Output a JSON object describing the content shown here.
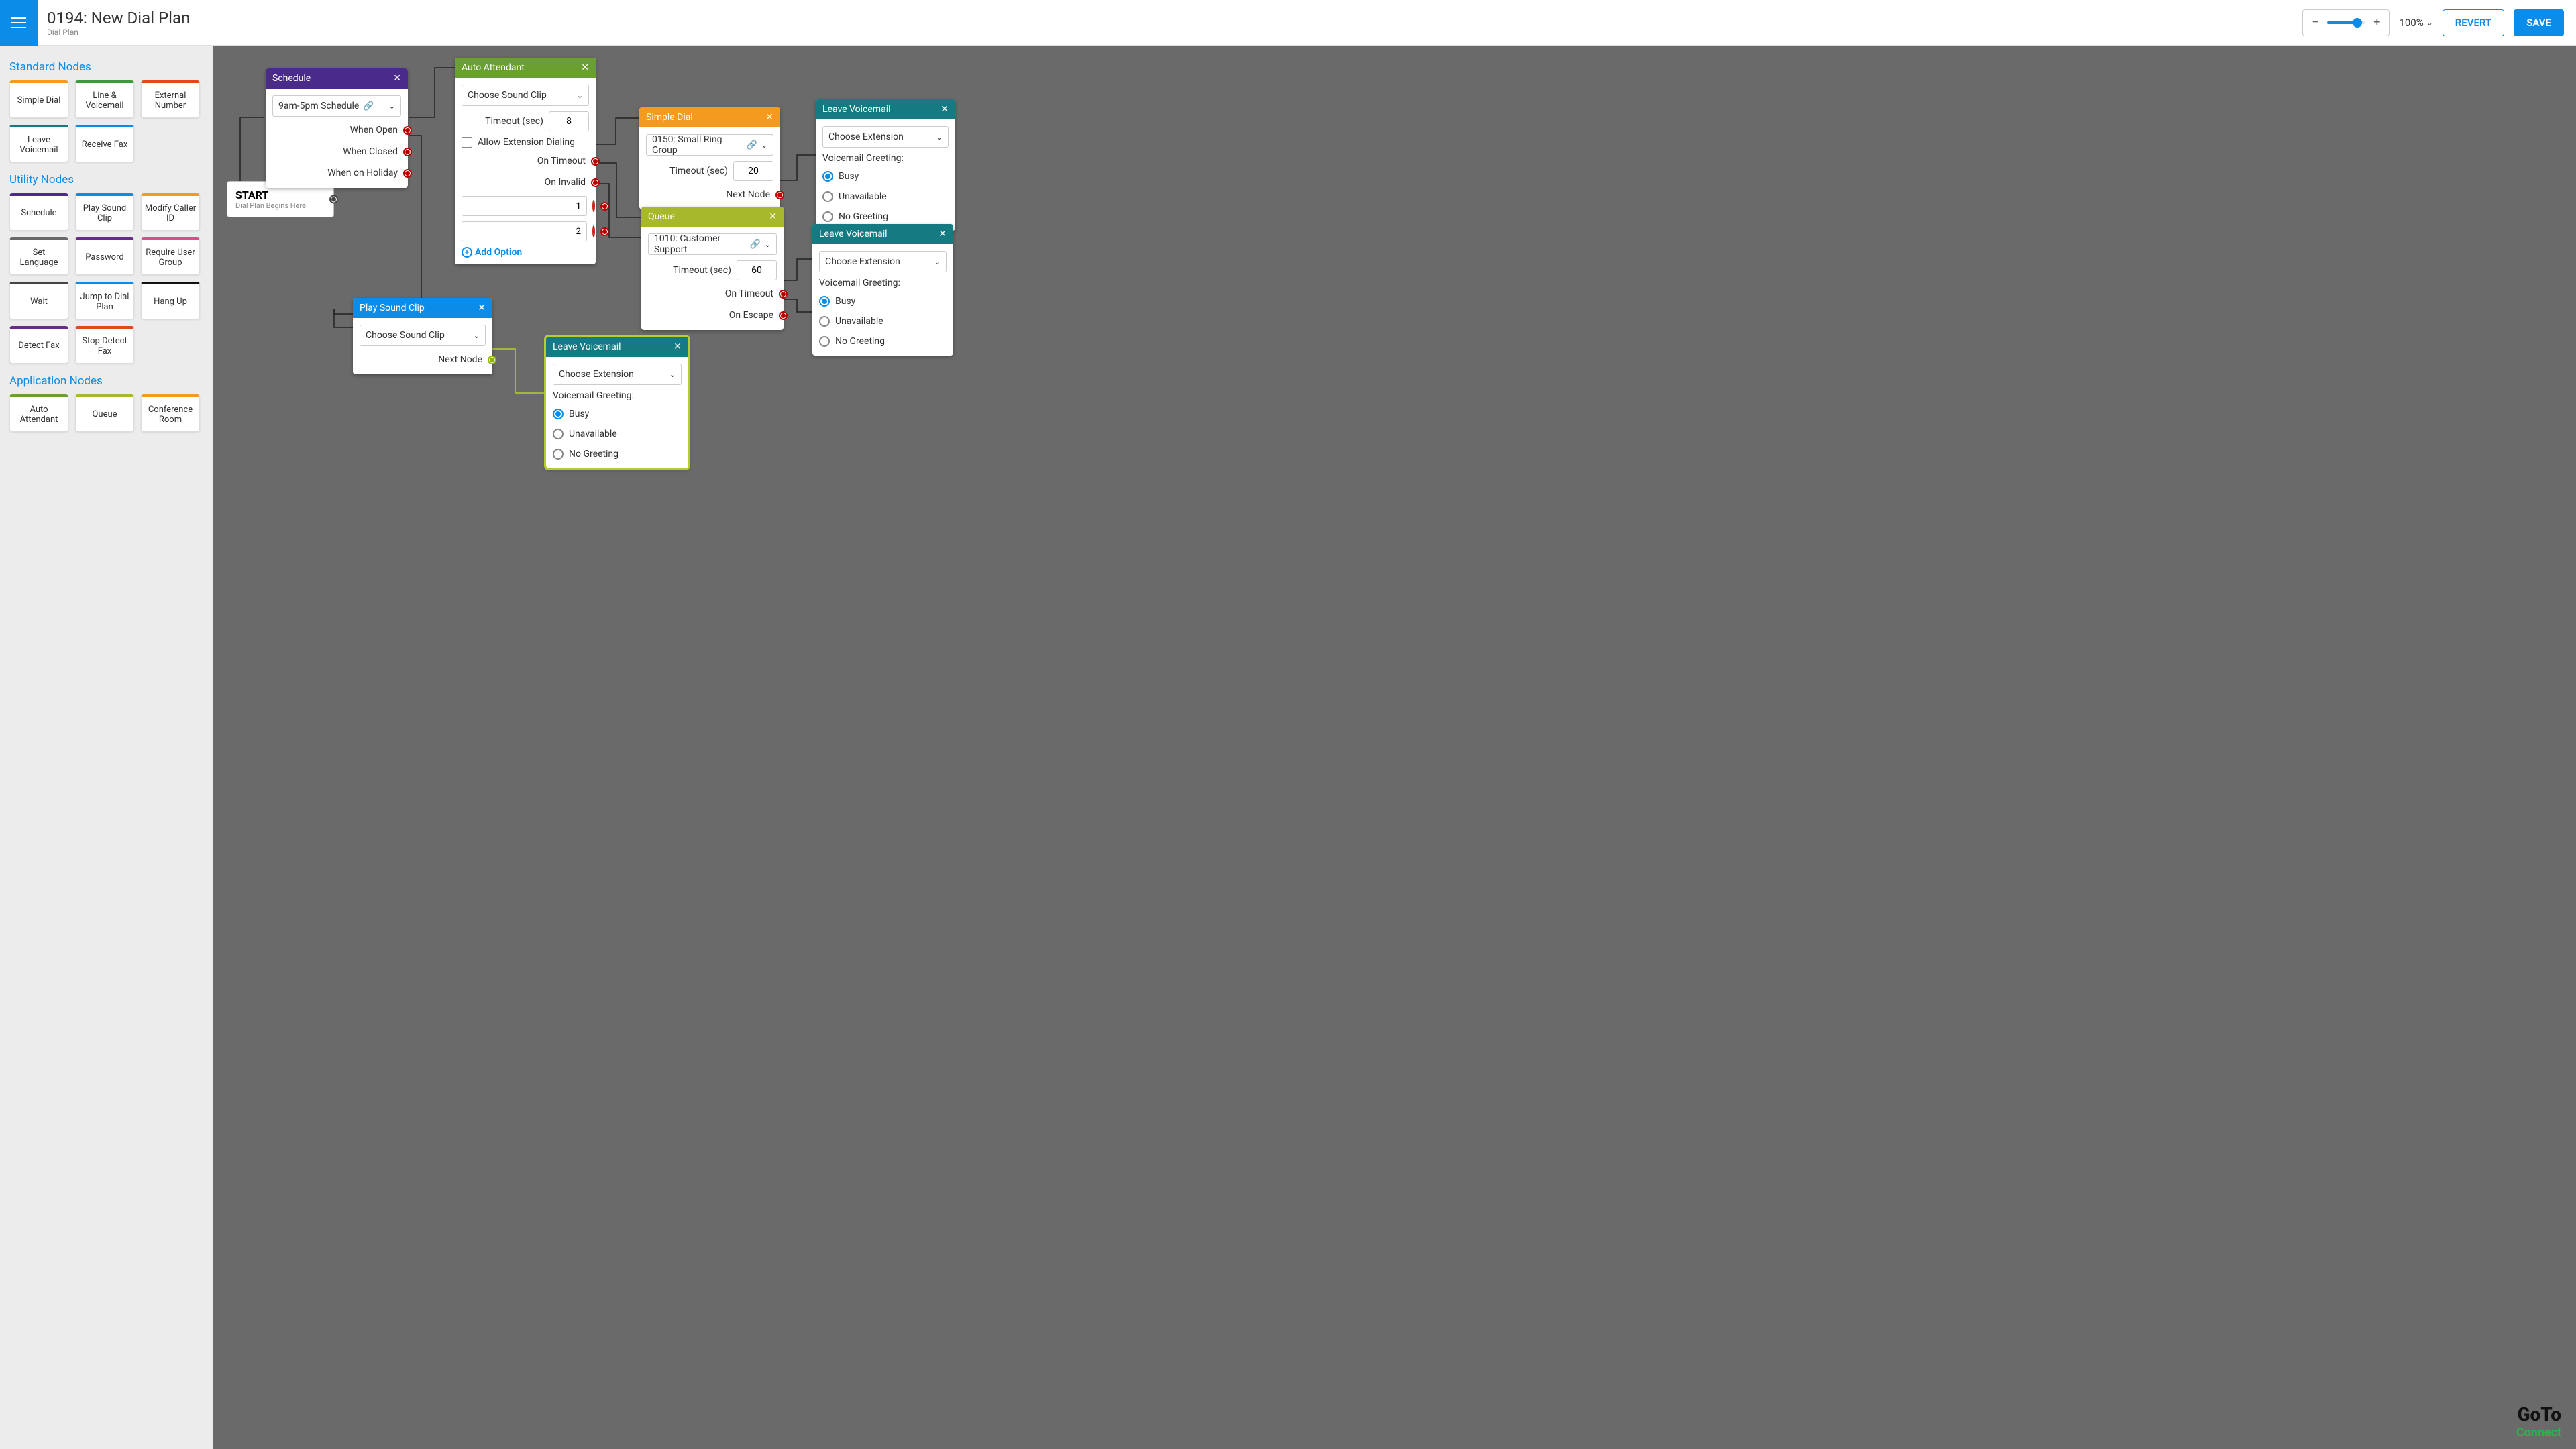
{
  "header": {
    "title": "0194: New Dial Plan",
    "subtitle": "Dial Plan"
  },
  "zoom": {
    "value": "100%"
  },
  "buttons": {
    "revert": "REVERT",
    "save": "SAVE"
  },
  "palette": {
    "standard": {
      "title": "Standard Nodes",
      "items": [
        {
          "label": "Simple Dial",
          "color": "#f39a1f"
        },
        {
          "label": "Line & Voicemail",
          "color": "#3b9b3b"
        },
        {
          "label": "External Number",
          "color": "#e04a1a"
        },
        {
          "label": "Leave Voicemail",
          "color": "#167a82"
        },
        {
          "label": "Receive Fax",
          "color": "#0c8ce9"
        }
      ]
    },
    "utility": {
      "title": "Utility Nodes",
      "items": [
        {
          "label": "Schedule",
          "color": "#4a2b8a"
        },
        {
          "label": "Play Sound Clip",
          "color": "#0c8ce9"
        },
        {
          "label": "Modify Caller ID",
          "color": "#f39a1f"
        },
        {
          "label": "Set Language",
          "color": "#6a6a6a"
        },
        {
          "label": "Password",
          "color": "#6a2a8a"
        },
        {
          "label": "Require User Group",
          "color": "#e24a8a"
        },
        {
          "label": "Wait",
          "color": "#444"
        },
        {
          "label": "Jump to Dial Plan",
          "color": "#0c8ce9"
        },
        {
          "label": "Hang Up",
          "color": "#111"
        },
        {
          "label": "Detect Fax",
          "color": "#6a2a8a"
        },
        {
          "label": "Stop Detect Fax",
          "color": "#e04a1a"
        }
      ]
    },
    "application": {
      "title": "Application Nodes",
      "items": [
        {
          "label": "Auto Attendant",
          "color": "#6aa032"
        },
        {
          "label": "Queue",
          "color": "#a7b82c"
        },
        {
          "label": "Conference Room",
          "color": "#f39a1f"
        }
      ]
    }
  },
  "start": {
    "title": "START",
    "subtitle": "Dial Plan Begins Here"
  },
  "schedule": {
    "title": "Schedule",
    "clip": "9am-5pm Schedule",
    "port1": "When Open",
    "port2": "When Closed",
    "port3": "When on Holiday"
  },
  "autoattendant": {
    "title": "Auto Attendant",
    "sound": "Choose Sound Clip",
    "timeout_label": "Timeout (sec)",
    "timeout_value": "8",
    "allow_ext": "Allow Extension Dialing",
    "port_timeout": "On Timeout",
    "port_invalid": "On Invalid",
    "opt1": "1",
    "opt2": "2",
    "add": "Add Option"
  },
  "playsound": {
    "title": "Play Sound Clip",
    "clip": "Choose Sound Clip",
    "next": "Next Node"
  },
  "simpledial": {
    "title": "Simple Dial",
    "target": "0150: Small Ring Group",
    "timeout_label": "Timeout (sec)",
    "timeout_value": "20",
    "next": "Next Node"
  },
  "queue": {
    "title": "Queue",
    "target": "1010: Customer Support",
    "timeout_label": "Timeout (sec)",
    "timeout_value": "60",
    "port_timeout": "On Timeout",
    "port_escape": "On Escape"
  },
  "voicemail": {
    "title": "Leave Voicemail",
    "ext": "Choose Extension",
    "greeting_label": "Voicemail Greeting:",
    "opt_busy": "Busy",
    "opt_unavail": "Unavailable",
    "opt_none": "No Greeting"
  },
  "brand": {
    "top": "GoTo",
    "bottom": "Connect"
  }
}
